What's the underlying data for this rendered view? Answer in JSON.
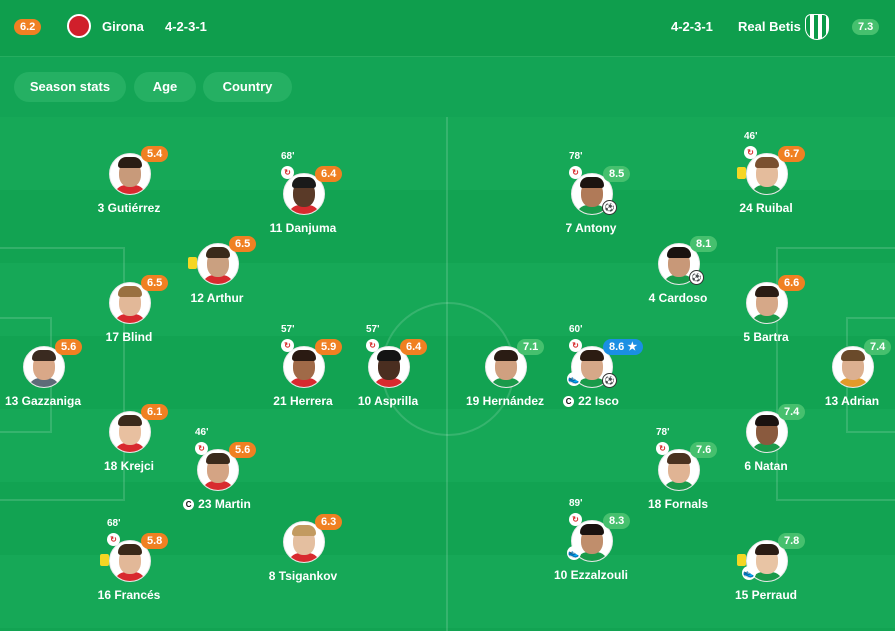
{
  "home": {
    "rating": "6.2",
    "name": "Girona",
    "formation": "4-2-3-1",
    "crest_color": "#d01f2b"
  },
  "away": {
    "rating": "7.3",
    "name": "Real Betis",
    "formation": "4-2-3-1",
    "crest_color": "#0a9a48"
  },
  "filters": [
    "Season stats",
    "Age",
    "Country"
  ],
  "players": [
    {
      "id": "p1",
      "label": "3 Gutiérrez",
      "rating": "5.4",
      "rc": "orange",
      "skin": "#c89a7a",
      "hair": "#2b1d14",
      "shirt": "#d82a2f"
    },
    {
      "id": "p2",
      "label": "11 Danjuma",
      "rating": "6.4",
      "rc": "orange",
      "minute": "68'",
      "sub": true,
      "skin": "#5a3a28",
      "hair": "#1a1a1a",
      "shirt": "#d82a2f"
    },
    {
      "id": "p3",
      "label": "12 Arthur",
      "rating": "6.5",
      "rc": "orange",
      "yellow": true,
      "skin": "#caa080",
      "hair": "#3a2a1a",
      "shirt": "#d82a2f"
    },
    {
      "id": "p4",
      "label": "17 Blind",
      "rating": "6.5",
      "rc": "orange",
      "skin": "#e2b898",
      "hair": "#9a7040",
      "shirt": "#d82a2f"
    },
    {
      "id": "p5",
      "label": "21 Herrera",
      "rating": "5.9",
      "rc": "orange",
      "minute": "57'",
      "sub": true,
      "skin": "#a06a48",
      "hair": "#2a1a12",
      "shirt": "#d82a2f"
    },
    {
      "id": "p6",
      "label": "10 Asprilla",
      "rating": "6.4",
      "rc": "orange",
      "minute": "57'",
      "sub": true,
      "skin": "#4a2e20",
      "hair": "#141414",
      "shirt": "#d82a2f"
    },
    {
      "id": "p7",
      "label": "13 Gazzaniga",
      "rating": "5.6",
      "rc": "orange",
      "skin": "#d9a888",
      "hair": "#3a2a20",
      "shirt": "#5d6b78"
    },
    {
      "id": "p8",
      "label": "18 Krejci",
      "rating": "6.1",
      "rc": "orange",
      "skin": "#e8c0a0",
      "hair": "#3b2a1c",
      "shirt": "#d82a2f"
    },
    {
      "id": "p9",
      "label": "23 Martin",
      "rating": "5.6",
      "rc": "orange",
      "minute": "46'",
      "sub": true,
      "captain": true,
      "skin": "#d4a484",
      "hair": "#3a2a1c",
      "shirt": "#d82a2f"
    },
    {
      "id": "p10",
      "label": "16 Francés",
      "rating": "5.8",
      "rc": "orange",
      "minute": "68'",
      "sub": true,
      "yellow": true,
      "skin": "#e2b898",
      "hair": "#3a2818",
      "shirt": "#d82a2f"
    },
    {
      "id": "p11",
      "label": "8 Tsigankov",
      "rating": "6.3",
      "rc": "orange",
      "skin": "#e4bfa0",
      "hair": "#c29a60",
      "shirt": "#d82a2f"
    },
    {
      "id": "p12",
      "label": "7 Antony",
      "rating": "8.5",
      "rc": "green",
      "minute": "78'",
      "sub": true,
      "goal": true,
      "skin": "#b07a58",
      "hair": "#1c1410",
      "shirt": "#1a9a4a"
    },
    {
      "id": "p13",
      "label": "24 Ruibal",
      "rating": "6.7",
      "rc": "orange",
      "minute": "46'",
      "sub": true,
      "yellow": true,
      "skin": "#e4bc9c",
      "hair": "#7a5030",
      "shirt": "#1a9a4a"
    },
    {
      "id": "p14",
      "label": "4 Cardoso",
      "rating": "8.1",
      "rc": "green",
      "goal": true,
      "skin": "#c89878",
      "hair": "#1a1210",
      "shirt": "#1a9a4a"
    },
    {
      "id": "p15",
      "label": "5 Bartra",
      "rating": "6.6",
      "rc": "orange",
      "skin": "#d6a888",
      "hair": "#2a1c14",
      "shirt": "#1a9a4a"
    },
    {
      "id": "p16",
      "label": "19 Hernández",
      "rating": "7.1",
      "rc": "green",
      "skin": "#d0a080",
      "hair": "#2a1c14",
      "shirt": "#1a9a4a"
    },
    {
      "id": "p17",
      "label": "22 Isco",
      "rating": "8.6",
      "rc": "blue",
      "star": "★",
      "minute": "60'",
      "sub": true,
      "goal": true,
      "assist": true,
      "captain": true,
      "skin": "#d6a888",
      "hair": "#2c1c12",
      "shirt": "#1a9a4a"
    },
    {
      "id": "p18",
      "label": "13 Adrian",
      "rating": "7.4",
      "rc": "green",
      "skin": "#dcb090",
      "hair": "#6a4a2a",
      "shirt": "#e39a2a"
    },
    {
      "id": "p19",
      "label": "6 Natan",
      "rating": "7.4",
      "rc": "green",
      "skin": "#8a5a3e",
      "hair": "#1a1210",
      "shirt": "#1a9a4a"
    },
    {
      "id": "p20",
      "label": "18 Fornals",
      "rating": "7.6",
      "rc": "green",
      "minute": "78'",
      "sub": true,
      "skin": "#e0b494",
      "hair": "#4a3220",
      "shirt": "#1a9a4a"
    },
    {
      "id": "p21",
      "label": "10 Ezzalzouli",
      "rating": "8.3",
      "rc": "green",
      "minute": "89'",
      "sub": true,
      "assist": true,
      "skin": "#c08e6c",
      "hair": "#1a1210",
      "shirt": "#1a9a4a"
    },
    {
      "id": "p22",
      "label": "15 Perraud",
      "rating": "7.8",
      "rc": "green",
      "yellow": true,
      "assist": true,
      "skin": "#e8c4a4",
      "hair": "#2a1c14",
      "shirt": "#1a9a4a"
    }
  ]
}
